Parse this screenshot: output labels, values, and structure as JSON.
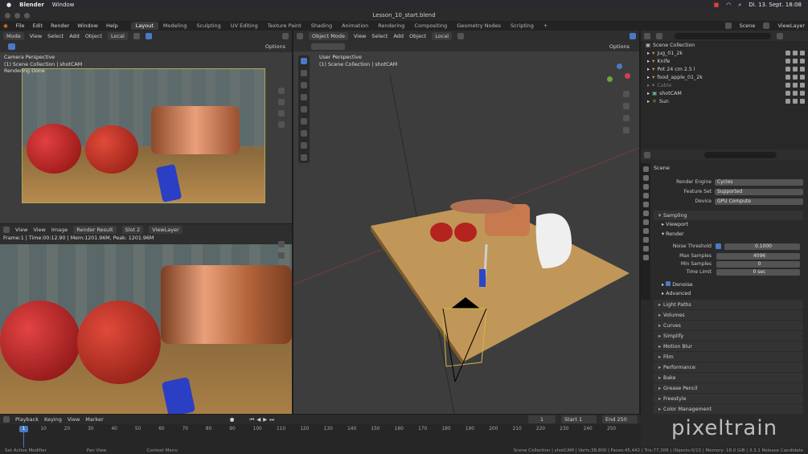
{
  "os_bar": {
    "app": "Blender",
    "menu": "Window",
    "datetime": "Di. 13. Sept. 18:08"
  },
  "window": {
    "title": "Lesson_10_start.blend"
  },
  "menus": [
    "File",
    "Edit",
    "Render",
    "Window",
    "Help"
  ],
  "workspaces": [
    "Layout",
    "Modeling",
    "Sculpting",
    "UV Editing",
    "Texture Paint",
    "Shading",
    "Animation",
    "Rendering",
    "Compositing",
    "Geometry Nodes",
    "Scripting",
    "+"
  ],
  "left_view": {
    "mode": "Mode",
    "menus": [
      "View",
      "Select",
      "Add",
      "Object"
    ],
    "transform": "Local",
    "options": "Options",
    "overlay": [
      "Camera Perspective",
      "(1) Scene Collection | shotCAM",
      "Rendering Done"
    ]
  },
  "image_editor": {
    "menus": [
      "View",
      "View",
      "Image"
    ],
    "image_name": "Render Result",
    "slot": "Slot 2",
    "layer": "ViewLayer",
    "info": "Frame:1 | Time:00:12.90 | Mem:1201.96M, Peak: 1201.96M"
  },
  "main_view": {
    "mode": "Object Mode",
    "menus": [
      "View",
      "Select",
      "Add",
      "Object"
    ],
    "transform": "Local",
    "options": "Options",
    "overlay": [
      "User Perspective",
      "(1) Scene Collection | shotCAM"
    ]
  },
  "outliner": {
    "scene": "Scene",
    "view_layer": "ViewLayer",
    "root": "Scene Collection",
    "items": [
      "jug_01_2k",
      "Knife",
      "Pot 24 cm 2.5 l",
      "food_apple_01_2k",
      "Cable",
      "shotCAM",
      "Sun"
    ]
  },
  "properties": {
    "context": "Scene",
    "render_engine_label": "Render Engine",
    "render_engine": "Cycles",
    "feature_set_label": "Feature Set",
    "feature_set": "Supported",
    "device_label": "Device",
    "device": "GPU Compute",
    "sampling": "Sampling",
    "viewport": "Viewport",
    "render": "Render",
    "noise_threshold_label": "Noise Threshold",
    "noise_threshold": "0.1000",
    "max_samples_label": "Max Samples",
    "max_samples": "4096",
    "min_samples_label": "Min Samples",
    "min_samples": "0",
    "time_limit_label": "Time Limit",
    "time_limit": "0 sec",
    "denoise": "Denoise",
    "advanced": "Advanced",
    "panels": [
      "Light Paths",
      "Volumes",
      "Curves",
      "Simplify",
      "Motion Blur",
      "Film",
      "Performance",
      "Bake",
      "Grease Pencil",
      "Freestyle",
      "Color Management"
    ]
  },
  "timeline": {
    "menus": [
      "Playback",
      "Keying",
      "View",
      "Marker"
    ],
    "current_frame": "1",
    "start_label": "Start",
    "start": "1",
    "end_label": "End",
    "end": "250",
    "ticks": [
      "1",
      "10",
      "20",
      "30",
      "40",
      "50",
      "60",
      "70",
      "80",
      "90",
      "100",
      "110",
      "120",
      "130",
      "140",
      "150",
      "160",
      "170",
      "180",
      "190",
      "200",
      "210",
      "220",
      "230",
      "240",
      "250"
    ]
  },
  "status": {
    "left": "Set Active Modifier",
    "mid": "Pan View",
    "ctx": "Context Menu",
    "right": "Scene Collection | shotCAM | Verts:38,800 | Faces:45,442 | Tris:77,306 | Objects:0/15 | Memory: 18.0 GiB | 3.3.1 Release Candidate"
  },
  "watermark": "pixeltrain"
}
